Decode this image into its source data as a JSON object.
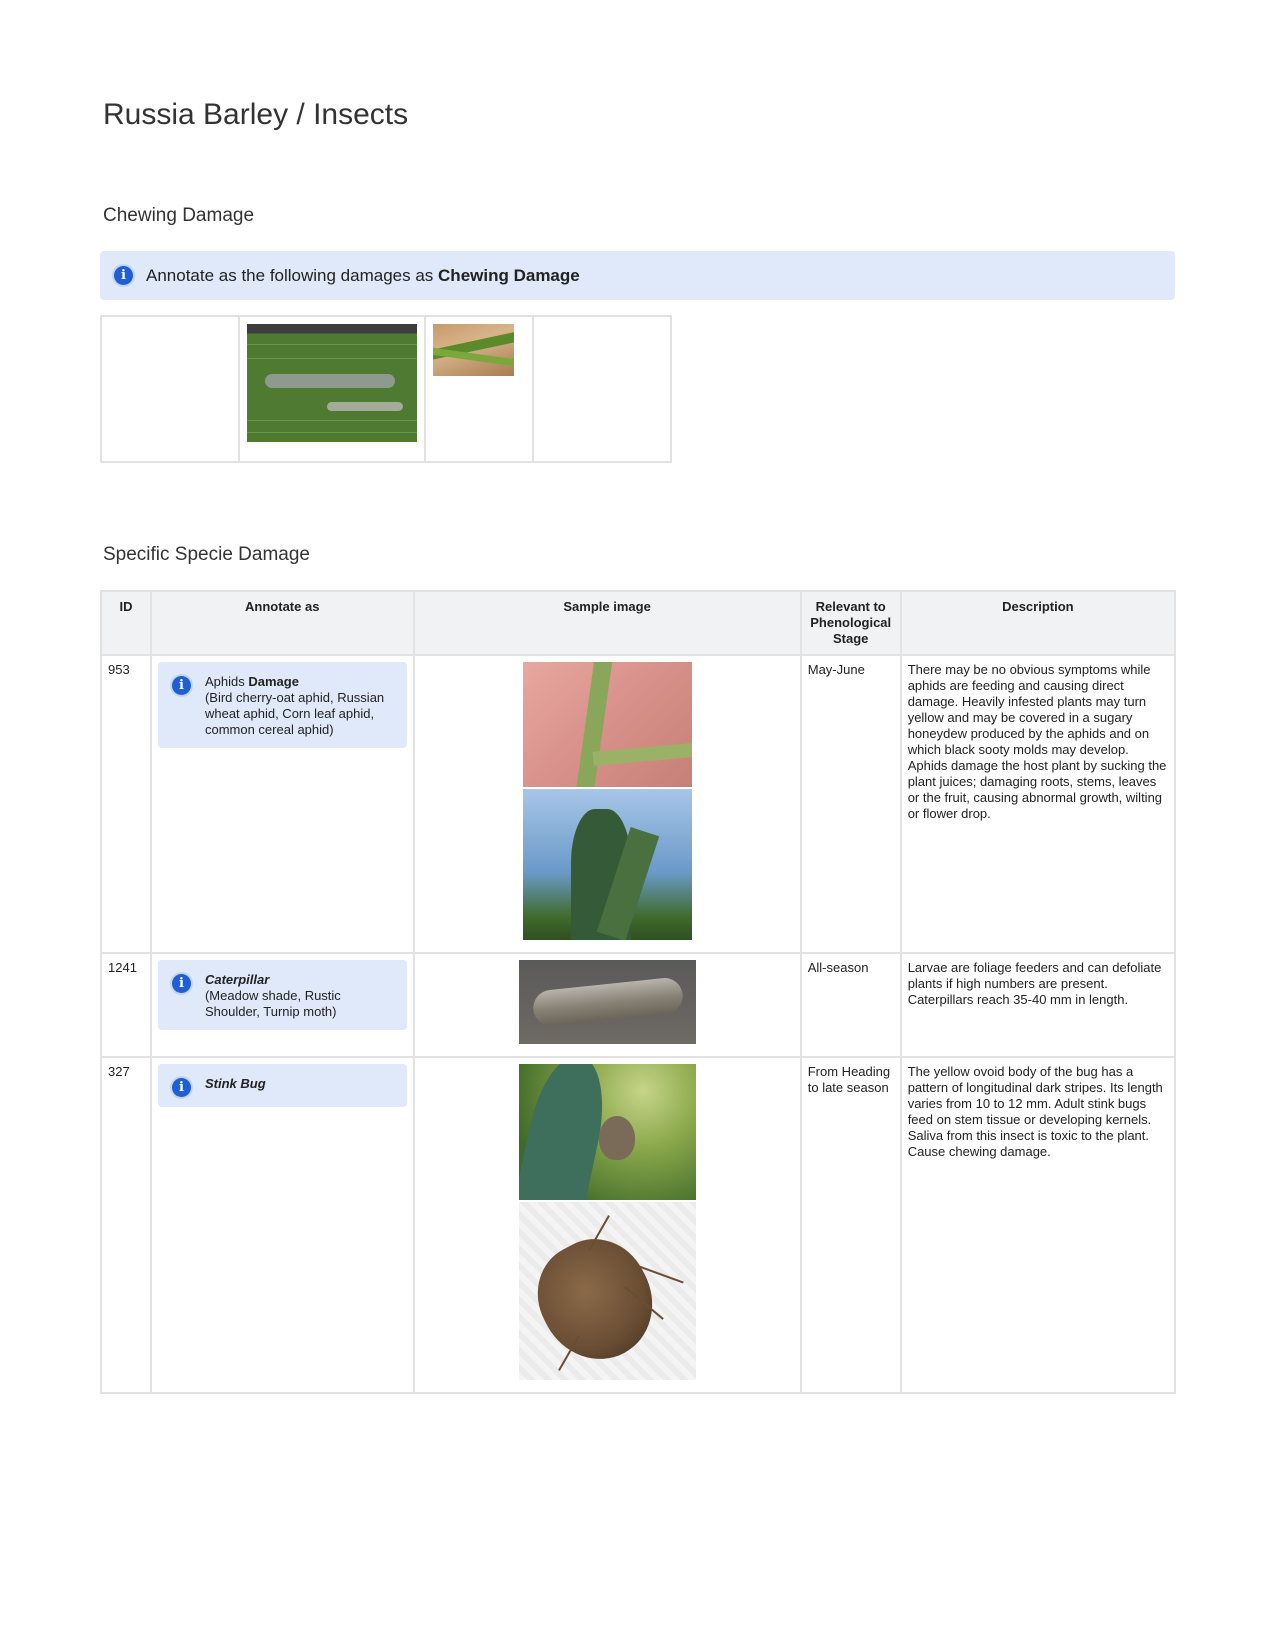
{
  "page": {
    "title": "Russia Barley / Insects"
  },
  "chewing": {
    "title": "Chewing Damage",
    "banner_prefix": "Annotate as the following damages as ",
    "banner_bold": "Chewing Damage"
  },
  "species": {
    "title": "Specific Specie Damage",
    "headers": {
      "id": "ID",
      "annotate": "Annotate as",
      "sample": "Sample image",
      "stage": "Relevant to Phenological Stage",
      "description": "Description"
    },
    "rows": [
      {
        "id": "953",
        "name_plain": "Aphids ",
        "name_bold": "Damage",
        "subtitle": "(Bird cherry-oat aphid, Russian wheat aphid, Corn leaf aphid, common cereal aphid)",
        "stage": "May-June",
        "description": "There may be no obvious symptoms while aphids are feeding and causing direct damage. Heavily infested plants may turn yellow and may be covered in a sugary honeydew produced by the aphids and on which black sooty molds may develop. Aphids damage the host plant by sucking the plant juices; damaging roots, stems, leaves or the fruit, causing abnormal growth, wilting or flower drop."
      },
      {
        "id": "1241",
        "name_bold": "Caterpillar",
        "subtitle": "(Meadow shade, Rustic Shoulder, Turnip moth)",
        "stage": "All-season",
        "description": "Larvae are foliage feeders and can defoliate plants if high numbers are present.  Caterpillars reach 35-40 mm in length."
      },
      {
        "id": "327",
        "name_bold": "Stink Bug",
        "stage": "From Heading to late season",
        "description": "The yellow ovoid body of the bug has a pattern of longitudinal dark stripes. Its length varies from 10 to 12 mm. Adult stink bugs feed on stem tissue or developing kernels. Saliva from this insect is toxic to the plant. Cause chewing damage."
      }
    ]
  }
}
